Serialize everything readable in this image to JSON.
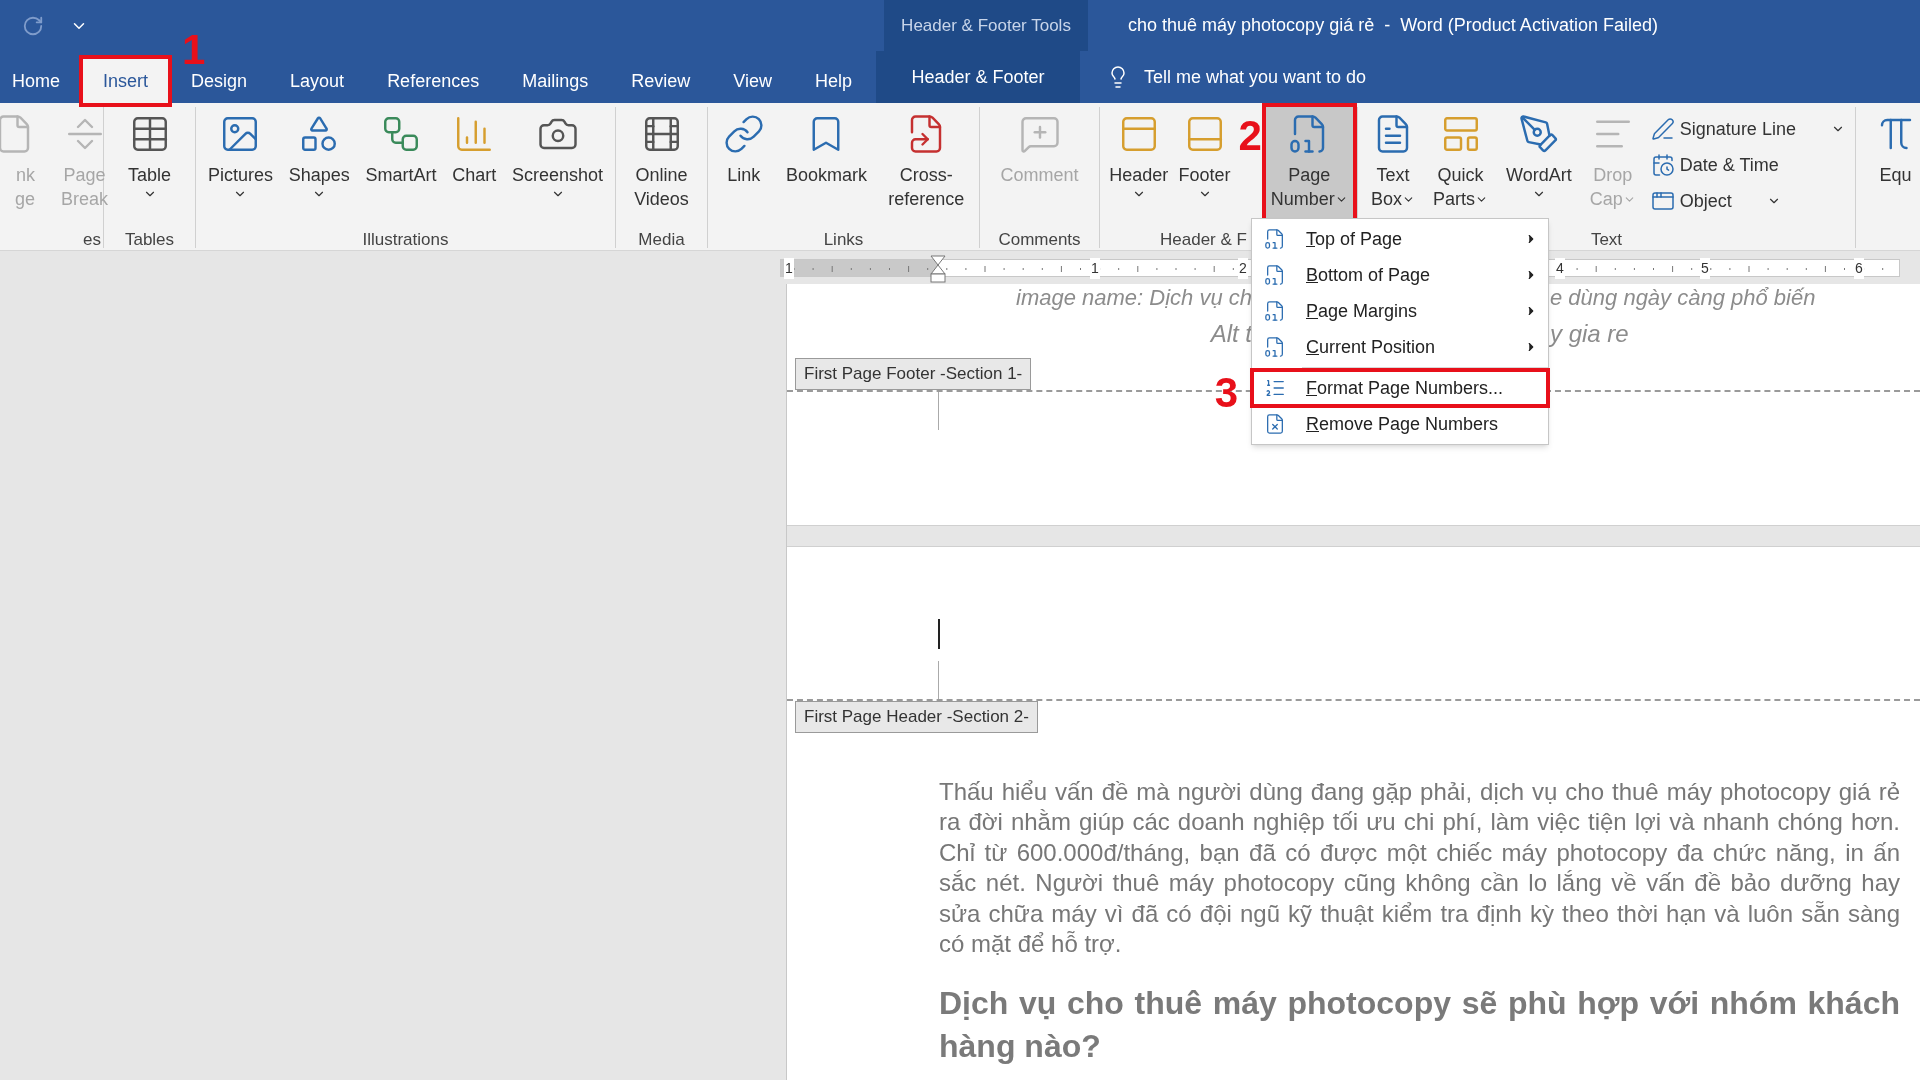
{
  "title_bar": {
    "context_label": "Header & Footer Tools",
    "title": "cho thuê máy photocopy giá rẻ  -  Word (Product Activation Failed)"
  },
  "tabs": [
    {
      "label": "Home",
      "selected": false,
      "marked": false
    },
    {
      "label": "Insert",
      "selected": true,
      "marked": true,
      "callout": "1"
    },
    {
      "label": "Design",
      "selected": false,
      "marked": false
    },
    {
      "label": "Layout",
      "selected": false,
      "marked": false
    },
    {
      "label": "References",
      "selected": false,
      "marked": false
    },
    {
      "label": "Mailings",
      "selected": false,
      "marked": false
    },
    {
      "label": "Review",
      "selected": false,
      "marked": false
    },
    {
      "label": "View",
      "selected": false,
      "marked": false
    },
    {
      "label": "Help",
      "selected": false,
      "marked": false
    }
  ],
  "context_tab": {
    "label": "Header & Footer"
  },
  "tell_me": {
    "placeholder": "Tell me what you want to do"
  },
  "ribbon": {
    "groups": [
      {
        "label": "es",
        "items": [
          {
            "kind": "large",
            "lines": [
              "nk",
              "ge"
            ],
            "dropdown": false,
            "disabled": true,
            "selected": false,
            "marked": false
          },
          {
            "kind": "large",
            "lines": [
              "Page",
              "Break"
            ],
            "dropdown": false,
            "disabled": true,
            "selected": false,
            "marked": false
          }
        ]
      },
      {
        "label": "Tables",
        "items": [
          {
            "kind": "large",
            "lines": [
              "Table"
            ],
            "dropdown": true,
            "disabled": false,
            "selected": false,
            "marked": false
          }
        ]
      },
      {
        "label": "Illustrations",
        "items": [
          {
            "kind": "large",
            "lines": [
              "Pictures"
            ],
            "dropdown": true,
            "disabled": false,
            "selected": false,
            "marked": false
          },
          {
            "kind": "large",
            "lines": [
              "Shapes"
            ],
            "dropdown": true,
            "disabled": false,
            "selected": false,
            "marked": false
          },
          {
            "kind": "large",
            "lines": [
              "SmartArt"
            ],
            "dropdown": false,
            "disabled": false,
            "selected": false,
            "marked": false
          },
          {
            "kind": "large",
            "lines": [
              "Chart"
            ],
            "dropdown": false,
            "disabled": false,
            "selected": false,
            "marked": false
          },
          {
            "kind": "large",
            "lines": [
              "Screenshot"
            ],
            "dropdown": true,
            "disabled": false,
            "selected": false,
            "marked": false
          }
        ]
      },
      {
        "label": "Media",
        "items": [
          {
            "kind": "large",
            "lines": [
              "Online",
              "Videos"
            ],
            "dropdown": false,
            "disabled": false,
            "selected": false,
            "marked": false
          }
        ]
      },
      {
        "label": "Links",
        "items": [
          {
            "kind": "large",
            "lines": [
              "Link"
            ],
            "dropdown": false,
            "disabled": false,
            "selected": false,
            "marked": false
          },
          {
            "kind": "large",
            "lines": [
              "Bookmark"
            ],
            "dropdown": false,
            "disabled": false,
            "selected": false,
            "marked": false
          },
          {
            "kind": "large",
            "lines": [
              "Cross-",
              "reference"
            ],
            "dropdown": false,
            "disabled": false,
            "selected": false,
            "marked": false
          }
        ]
      },
      {
        "label": "Comments",
        "items": [
          {
            "kind": "large",
            "lines": [
              "Comment"
            ],
            "dropdown": false,
            "disabled": true,
            "selected": false,
            "marked": false
          }
        ]
      },
      {
        "label": "Header & F",
        "items": [
          {
            "kind": "large",
            "lines": [
              "Header"
            ],
            "dropdown": true,
            "disabled": false,
            "selected": false,
            "marked": false
          },
          {
            "kind": "large",
            "lines": [
              "Footer"
            ],
            "dropdown": true,
            "disabled": false,
            "selected": false,
            "marked": false
          },
          {
            "kind": "large",
            "lines": [
              "Page",
              "Number"
            ],
            "dropdown": true,
            "disabled": false,
            "selected": true,
            "marked": true,
            "callout": "2"
          }
        ]
      },
      {
        "label": "Text",
        "items": [
          {
            "kind": "large",
            "lines": [
              "Text",
              "Box"
            ],
            "dropdown": true,
            "disabled": false,
            "selected": false,
            "marked": false
          },
          {
            "kind": "large",
            "lines": [
              "Quick",
              "Parts"
            ],
            "dropdown": true,
            "disabled": false,
            "selected": false,
            "marked": false
          },
          {
            "kind": "large",
            "lines": [
              "WordArt"
            ],
            "dropdown": true,
            "disabled": false,
            "selected": false,
            "marked": false
          },
          {
            "kind": "large",
            "lines": [
              "Drop",
              "Cap"
            ],
            "dropdown": true,
            "disabled": true,
            "selected": false,
            "marked": false
          },
          {
            "kind": "small",
            "lines": [
              "Signature Line"
            ],
            "dropdown": true,
            "disabled": false
          },
          {
            "kind": "small",
            "lines": [
              "Date & Time"
            ],
            "dropdown": false,
            "disabled": false
          },
          {
            "kind": "small",
            "lines": [
              "Object"
            ],
            "dropdown": true,
            "disabled": false
          }
        ]
      },
      {
        "items": [
          {
            "kind": "large",
            "lines": [
              "Equ"
            ],
            "dropdown": false,
            "disabled": false,
            "selected": false,
            "marked": false
          }
        ]
      }
    ]
  },
  "menu": {
    "items": [
      {
        "label": "Top of Page",
        "submenu": true,
        "separator_before": false,
        "marked": false
      },
      {
        "label": "Bottom of Page",
        "submenu": true,
        "separator_before": false,
        "marked": false
      },
      {
        "label": "Page Margins",
        "submenu": true,
        "separator_before": false,
        "marked": false
      },
      {
        "label": "Current Position",
        "submenu": true,
        "separator_before": false,
        "marked": false
      },
      {
        "label": "Format Page Numbers...",
        "submenu": false,
        "separator_before": true,
        "marked": true,
        "callout": "3"
      },
      {
        "label": "Remove Page Numbers",
        "submenu": false,
        "separator_before": false,
        "marked": false
      }
    ]
  },
  "ruler": {
    "labels": [
      "1",
      "1",
      "2",
      "4",
      "5",
      "6"
    ]
  },
  "document": {
    "covered_lines": [
      {
        "left": "image name: Dịch vụ ch",
        "right": "e dùng ngày càng phổ biến"
      },
      {
        "left": "Alt t",
        "right": "y gia re"
      }
    ],
    "footer_tag": "First Page Footer -Section 1-",
    "header_tag": "First Page Header -Section 2-",
    "paragraph": "Thấu hiểu vấn đề mà người dùng đang gặp phải, dịch vụ cho thuê máy photocopy giá rẻ ra đời nhằm giúp các doanh nghiệp tối ưu chi phí, làm việc tiện lợi và nhanh chóng hơn. Chỉ từ 600.000đ/tháng, bạn đã có được một chiếc máy photocopy đa chức năng, in ấn sắc nét. Người thuê máy photocopy cũng không cần lo lắng về vấn đề bảo dưỡng hay sửa chữa máy vì đã có đội ngũ kỹ thuật kiểm tra định kỳ theo thời hạn và luôn sẵn sàng có mặt để hỗ trợ.",
    "heading": "Dịch vụ cho thuê máy photocopy sẽ phù hợp với nhóm khách hàng nào?"
  }
}
